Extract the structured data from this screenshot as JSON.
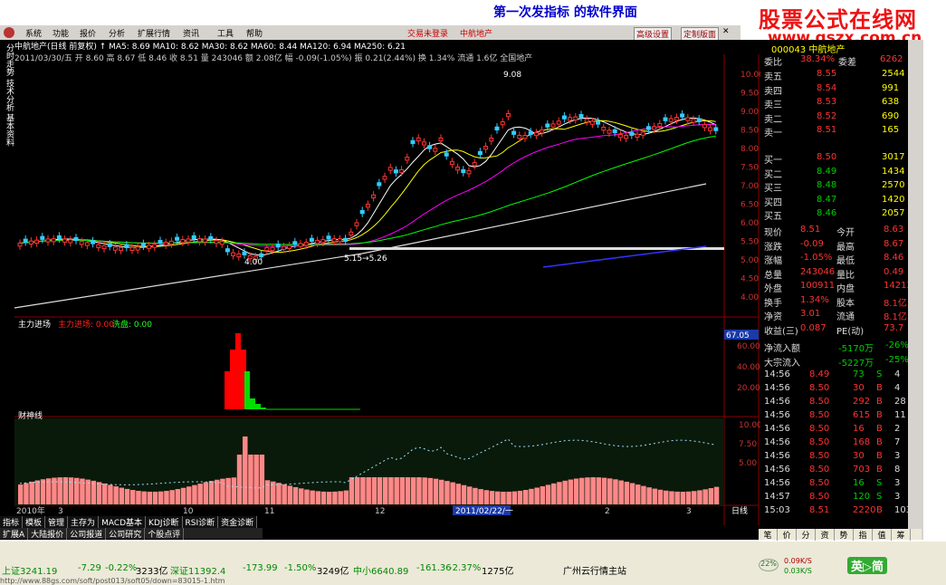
{
  "banner": {
    "title": "第一次发指标 的软件界面"
  },
  "watermark": {
    "name": "股票公式在线网",
    "url": "www.gszx.com.cn"
  },
  "menu": {
    "items": [
      "系统",
      "功能",
      "报价",
      "分析",
      "扩展行情",
      "资讯",
      "工具",
      "帮助"
    ],
    "center": "交易未登录",
    "trade": "中航地产",
    "btn1": "高级设置",
    "btn2": "定制版面",
    "win": "✕"
  },
  "lefttabs": {
    "label": "分时走势 技术分析 基本资料"
  },
  "quote": {
    "line1": "中航地产(日线 前复权)  ↑ MA5: 8.69  MA10: 8.62  MA30: 8.62  MA60: 8.44  MA120: 6.94  MA250: 6.21",
    "line2": "2011/03/30/五  开 8.60  高 8.67  低 8.46  收 8.51  量 243046  额 2.08亿  幅 -0.09(-1.05%)  振 0.21(2.44%)  换 1.34%  流通 1.6亿  全国地产"
  },
  "chart_labels": {
    "ind1_title": "主力进场",
    "ind1_a": "主力进场: 0.00",
    "ind1_b": "洗盘: 0.00",
    "ind2_title": "财神线",
    "peak_label": "9.08",
    "low_label": "4.00",
    "low2_label": "5.15→5.26",
    "cursor_date": "2011/02/22/一",
    "x_ticks": [
      "2010年",
      "3",
      "10",
      "11",
      "12",
      "2",
      "3"
    ],
    "price_ticks": [
      "10.00",
      "9.50",
      "9.00",
      "8.50",
      "8.00",
      "7.50",
      "7.00",
      "6.50",
      "6.00",
      "5.50",
      "5.00",
      "4.50",
      "4.00"
    ],
    "ind1_ticks": [
      "67.05",
      "60.00",
      "40.00",
      "20.00"
    ],
    "ind2_ticks": [
      "10.00",
      "7.50",
      "5.00"
    ],
    "cursor_price": "67.05",
    "day_label": "日线"
  },
  "rpanel": {
    "header": "000043 中航地产",
    "weibi": {
      "label": "委比",
      "value": "38.34%",
      "label2": "委差",
      "value2": "6262"
    },
    "sells": [
      {
        "label": "卖五",
        "price": "8.55",
        "vol": "2544"
      },
      {
        "label": "卖四",
        "price": "8.54",
        "vol": "991"
      },
      {
        "label": "卖三",
        "price": "8.53",
        "vol": "638"
      },
      {
        "label": "卖二",
        "price": "8.52",
        "vol": "690"
      },
      {
        "label": "卖一",
        "price": "8.51",
        "vol": "165"
      }
    ],
    "buys": [
      {
        "label": "买一",
        "price": "8.50",
        "vol": "3017"
      },
      {
        "label": "买二",
        "price": "8.49",
        "vol": "1434"
      },
      {
        "label": "买三",
        "price": "8.48",
        "vol": "2570"
      },
      {
        "label": "买四",
        "price": "8.47",
        "vol": "1420"
      },
      {
        "label": "买五",
        "price": "8.46",
        "vol": "2057"
      }
    ],
    "stats": [
      {
        "l1": "现价",
        "v1": "8.51",
        "l2": "今开",
        "v2": "8.63"
      },
      {
        "l1": "涨跌",
        "v1": "-0.09",
        "l2": "最高",
        "v2": "8.67"
      },
      {
        "l1": "涨幅",
        "v1": "-1.05%",
        "l2": "最低",
        "v2": "8.46"
      },
      {
        "l1": "总量",
        "v1": "243046",
        "l2": "量比",
        "v2": "0.49"
      },
      {
        "l1": "外盘",
        "v1": "100911",
        "l2": "内盘",
        "v2": "142135"
      },
      {
        "l1": "换手",
        "v1": "1.34%",
        "l2": "股本",
        "v2": "8.1亿"
      },
      {
        "l1": "净资",
        "v1": "3.01",
        "l2": "流通",
        "v2": "8.1亿"
      },
      {
        "l1": "收益(三)",
        "v1": "0.087",
        "l2": "PE(动)",
        "v2": "73.7"
      }
    ],
    "flow": [
      {
        "label": "净流入额",
        "value": "-5170万",
        "pct": "-26%"
      },
      {
        "label": "大宗流入",
        "value": "-5227万",
        "pct": "-25%"
      }
    ],
    "ticks": [
      {
        "t": "14:56",
        "p": "8.49",
        "v": "73",
        "d": "S",
        "n": "4"
      },
      {
        "t": "14:56",
        "p": "8.50",
        "v": "30",
        "d": "B",
        "n": "4"
      },
      {
        "t": "14:56",
        "p": "8.50",
        "v": "292",
        "d": "B",
        "n": "28"
      },
      {
        "t": "14:56",
        "p": "8.50",
        "v": "615",
        "d": "B",
        "n": "11"
      },
      {
        "t": "14:56",
        "p": "8.50",
        "v": "16",
        "d": "B",
        "n": "2"
      },
      {
        "t": "14:56",
        "p": "8.50",
        "v": "168",
        "d": "B",
        "n": "7"
      },
      {
        "t": "14:56",
        "p": "8.50",
        "v": "30",
        "d": "B",
        "n": "3"
      },
      {
        "t": "14:56",
        "p": "8.50",
        "v": "703",
        "d": "B",
        "n": "8"
      },
      {
        "t": "14:56",
        "p": "8.50",
        "v": "16",
        "d": "S",
        "n": "3"
      },
      {
        "t": "14:57",
        "p": "8.50",
        "v": "120",
        "d": "S",
        "n": "3"
      },
      {
        "t": "15:03",
        "p": "8.51",
        "v": "2220",
        "d": "B",
        "n": "103"
      }
    ]
  },
  "tabs": {
    "row1": [
      "指标",
      "模板",
      "管理",
      "主存为",
      "MACD基本",
      "KDJ诊断",
      "RSI诊断",
      "资金诊断"
    ],
    "row2": [
      "扩展A",
      "大陆报价",
      "公司报道",
      "公司研究",
      "个股点评"
    ]
  },
  "bottomtabs": [
    "笔",
    "价",
    "分",
    "资",
    "势",
    "指",
    "值",
    "筹"
  ],
  "status": {
    "sh": "上证3241.19",
    "sh_chg": "-7.29",
    "sh_pct": "-0.22%",
    "sh_amt": "3233亿",
    "sz": "深证11392.4",
    "sz_chg": "-173.99",
    "sz_pct": "-1.50%",
    "sz_amt": "3249亿",
    "zx": "中小6640.89",
    "zx_chg": "-161.36",
    "zx_pct": "-2.37%",
    "zx_amt": "1275亿",
    "info": "广州云行情主站",
    "speed": "22%",
    "net1": "0.09K/S",
    "net2": "0.03K/S",
    "brand": "英▷简"
  },
  "url": "http://www.88gs.com/soft/post013/soft05/down=83015-1.htm"
}
